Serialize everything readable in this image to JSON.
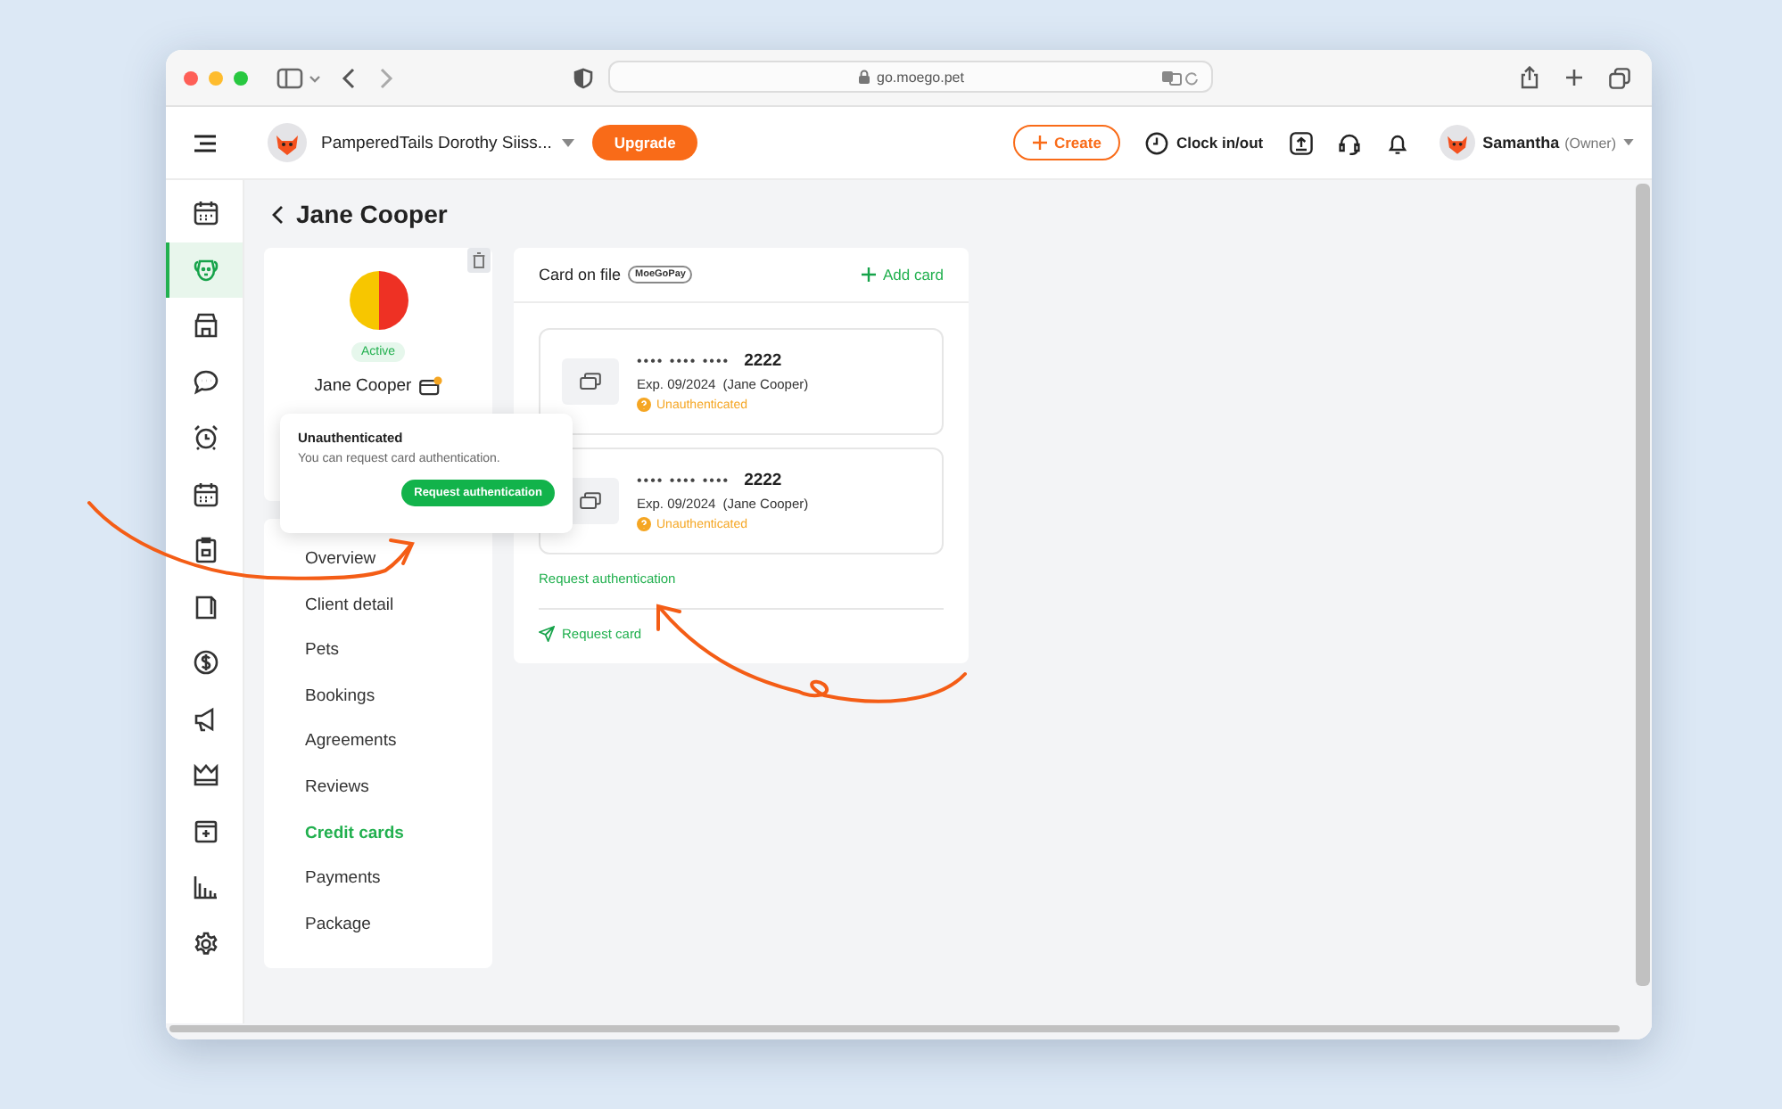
{
  "browser": {
    "url": "go.moego.pet"
  },
  "header": {
    "business": "PamperedTails Dorothy Siiss...",
    "upgrade": "Upgrade",
    "create": "Create",
    "clock": "Clock in/out",
    "user": "Samantha",
    "role": "(Owner)"
  },
  "rail": [
    {
      "kind": "calendar",
      "selected": false
    },
    {
      "kind": "dog",
      "selected": true
    },
    {
      "kind": "store",
      "selected": false
    },
    {
      "kind": "chat",
      "selected": false
    },
    {
      "kind": "alarm",
      "selected": false
    },
    {
      "kind": "schedule",
      "selected": false
    },
    {
      "kind": "clipboard",
      "selected": false
    },
    {
      "kind": "document",
      "selected": false
    },
    {
      "kind": "dollar",
      "selected": false
    },
    {
      "kind": "megaphone",
      "selected": false
    },
    {
      "kind": "crown",
      "selected": false
    },
    {
      "kind": "box",
      "selected": false
    },
    {
      "kind": "chart",
      "selected": false
    },
    {
      "kind": "gear",
      "selected": false
    }
  ],
  "page_title": "Jane Cooper",
  "client": {
    "status": "Active",
    "name": "Jane Cooper"
  },
  "tooltip": {
    "title": "Unauthenticated",
    "text": "You can request card authentication.",
    "button": "Request authentication"
  },
  "nav": [
    {
      "label": "Overview",
      "selected": false
    },
    {
      "label": "Client detail",
      "selected": false
    },
    {
      "label": "Pets",
      "selected": false
    },
    {
      "label": "Bookings",
      "selected": false
    },
    {
      "label": "Agreements",
      "selected": false
    },
    {
      "label": "Reviews",
      "selected": false
    },
    {
      "label": "Credit cards",
      "selected": true
    },
    {
      "label": "Payments",
      "selected": false
    },
    {
      "label": "Package",
      "selected": false
    }
  ],
  "cards_panel": {
    "title": "Card on file",
    "badge": "MoeGoPay",
    "add": "Add card",
    "cards": [
      {
        "number": "•••• •••• ••••",
        "last4": "2222",
        "exp": "Exp. 09/2024",
        "holder": "(Jane Cooper)",
        "status": "Unauthenticated"
      },
      {
        "number": "•••• •••• ••••",
        "last4": "2222",
        "exp": "Exp. 09/2024",
        "holder": "(Jane Cooper)",
        "status": "Unauthenticated"
      }
    ],
    "link": "Request authentication",
    "request": "Request card"
  }
}
